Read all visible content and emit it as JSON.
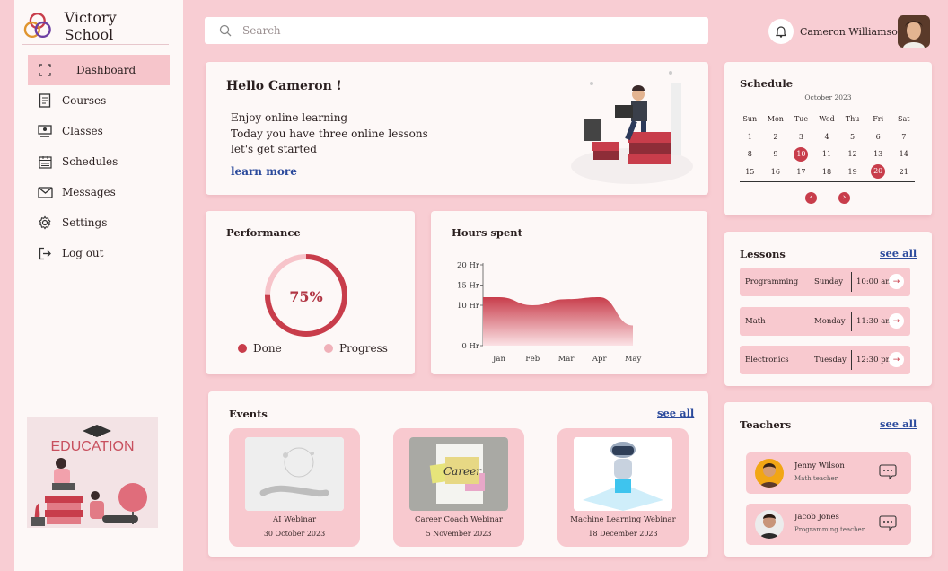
{
  "sidebar": {
    "brand": "Victory School",
    "items": [
      {
        "label": "Dashboard",
        "icon": "dashboard-icon",
        "active": true
      },
      {
        "label": "Courses",
        "icon": "courses-icon"
      },
      {
        "label": "Classes",
        "icon": "classes-icon"
      },
      {
        "label": "Schedules",
        "icon": "schedules-icon"
      },
      {
        "label": "Messages",
        "icon": "messages-icon"
      },
      {
        "label": "Settings",
        "icon": "settings-icon"
      },
      {
        "label": "Log out",
        "icon": "logout-icon"
      }
    ],
    "illustration_text": "EDUCATION"
  },
  "search": {
    "placeholder": "Search"
  },
  "user": {
    "name": "Cameron Williamson"
  },
  "hello": {
    "title": "Hello Cameron !",
    "line1": "Enjoy online learning",
    "line2": "Today you have three online lessons",
    "line3": "let's get started",
    "link": "learn more"
  },
  "performance": {
    "title": "Performance",
    "percent_label": "75%",
    "done_fraction": 0.75,
    "legend_done": "Done",
    "legend_progress": "Progress"
  },
  "chart_data": {
    "type": "area",
    "title": "Hours spent",
    "categories": [
      "Jan",
      "Feb",
      "Mar",
      "Apr",
      "May"
    ],
    "y_ticks": [
      "20 Hr",
      "15 Hr",
      "10 Hr",
      "0 Hr"
    ],
    "ylim": [
      0,
      20
    ],
    "series": [
      {
        "values": [
          12,
          10,
          11.5,
          12,
          5
        ]
      }
    ]
  },
  "events": {
    "title": "Events",
    "see_all": "see all",
    "items": [
      {
        "title": "AI Webinar",
        "date": "30 October 2023"
      },
      {
        "title": "Career Coach Webinar",
        "date": "5 November 2023",
        "thumb_text": "Career"
      },
      {
        "title": "Machine Learning Webinar",
        "date": "18 December 2023"
      }
    ]
  },
  "schedule": {
    "title": "Schedule",
    "month": "October 2023",
    "weekdays": [
      "Sun",
      "Mon",
      "Tue",
      "Wed",
      "Thu",
      "Fri",
      "Sat"
    ],
    "weeks": [
      [
        "1",
        "2",
        "3",
        "4",
        "5",
        "6",
        "7"
      ],
      [
        "8",
        "9",
        "10",
        "11",
        "12",
        "13",
        "14"
      ],
      [
        "15",
        "16",
        "17",
        "18",
        "19",
        "20",
        "21"
      ]
    ],
    "highlighted": [
      "10",
      "20"
    ],
    "prev": "‹",
    "next": "›"
  },
  "lessons": {
    "title": "Lessons",
    "see_all": "see all",
    "items": [
      {
        "name": "Programming",
        "day": "Sunday",
        "time": "10:00 am"
      },
      {
        "name": "Math",
        "day": "Monday",
        "time": "11:30 am"
      },
      {
        "name": "Electronics",
        "day": "Tuesday",
        "time": "12:30 pm"
      }
    ]
  },
  "teachers": {
    "title": "Teachers",
    "see_all": "see all",
    "items": [
      {
        "name": "Jenny Wilson",
        "role": "Math teacher"
      },
      {
        "name": "Jacob Jones",
        "role": "Programming teacher"
      }
    ]
  },
  "colors": {
    "background": "#f8cdd3",
    "accent": "#c83d4b",
    "link": "#2b4a9c",
    "card": "#fdf8f7"
  }
}
